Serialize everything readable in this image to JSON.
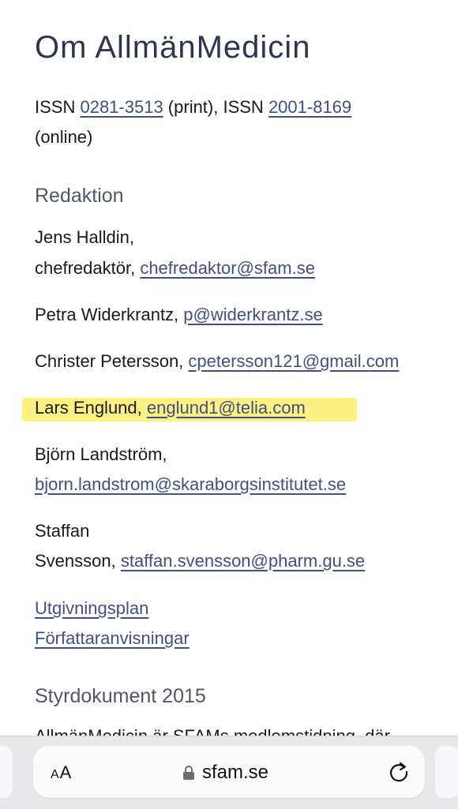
{
  "page": {
    "title": "Om AllmänMedicin",
    "issn": {
      "prefix1": "ISSN ",
      "print_number": "0281-3513",
      "print_suffix": " (print), ISSN ",
      "online_number": "2001-8169",
      "online_suffix": "(online)"
    },
    "redaktion_heading": "Redaktion",
    "editors": [
      {
        "name": "Jens Halldin,",
        "role": "chefredaktör, ",
        "email": "chefredaktor@sfam.se"
      },
      {
        "name": "Petra Widerkrantz, ",
        "email": "p@widerkrantz.se"
      },
      {
        "name": "Christer Petersson, ",
        "email": "cpetersson121@gmail.com"
      },
      {
        "name": "Lars Englund, ",
        "email": "englund1@telia.com"
      },
      {
        "name": "Björn Landström,",
        "email": "bjorn.landstrom@skaraborgsinstitutet.se"
      },
      {
        "name": "Staffan",
        "name2": "Svensson, ",
        "email": "staffan.svensson@pharm.gu.se"
      }
    ],
    "links": [
      "Utgivningsplan",
      "Författaranvisningar"
    ],
    "styr_heading": "Styrdokument 2015",
    "cut_text": "AllmänMedicin är SFAMs medlemstidning, där"
  },
  "browser": {
    "text_size_label_small": "A",
    "text_size_label_large": "A",
    "url": "sfam.se",
    "icons": [
      "lock-icon",
      "reload-icon"
    ]
  },
  "colors": {
    "link": "#3f5089",
    "highlight": "#fcf07a",
    "heading": "#2e3552"
  }
}
